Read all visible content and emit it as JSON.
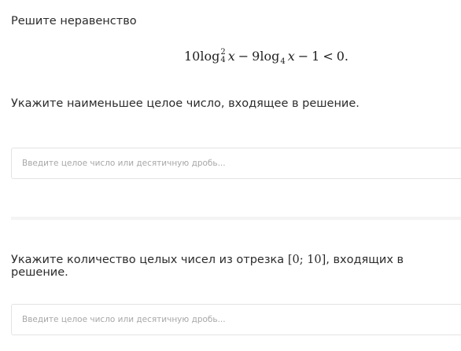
{
  "task": {
    "title": "Решите неравенство",
    "formula": {
      "coef1": "10",
      "log1": "log",
      "exp": "2",
      "base1": "4",
      "var1": "x",
      "minus1": "−",
      "coef2": "9",
      "log2": "log",
      "base2": "4",
      "var2": "x",
      "minus2": "−",
      "one": "1",
      "lt": "<",
      "zero": "0."
    }
  },
  "questions": [
    {
      "text": "Укажите наименьшее целое число, входящее в решение.",
      "placeholder": "Введите целое число или десятичную дробь..."
    },
    {
      "text_before": "Укажите количество целых чисел из отрезка ",
      "math": "[0; 10]",
      "text_after": ", входящих в решение.",
      "placeholder": "Введите целое число или десятичную дробь..."
    }
  ]
}
